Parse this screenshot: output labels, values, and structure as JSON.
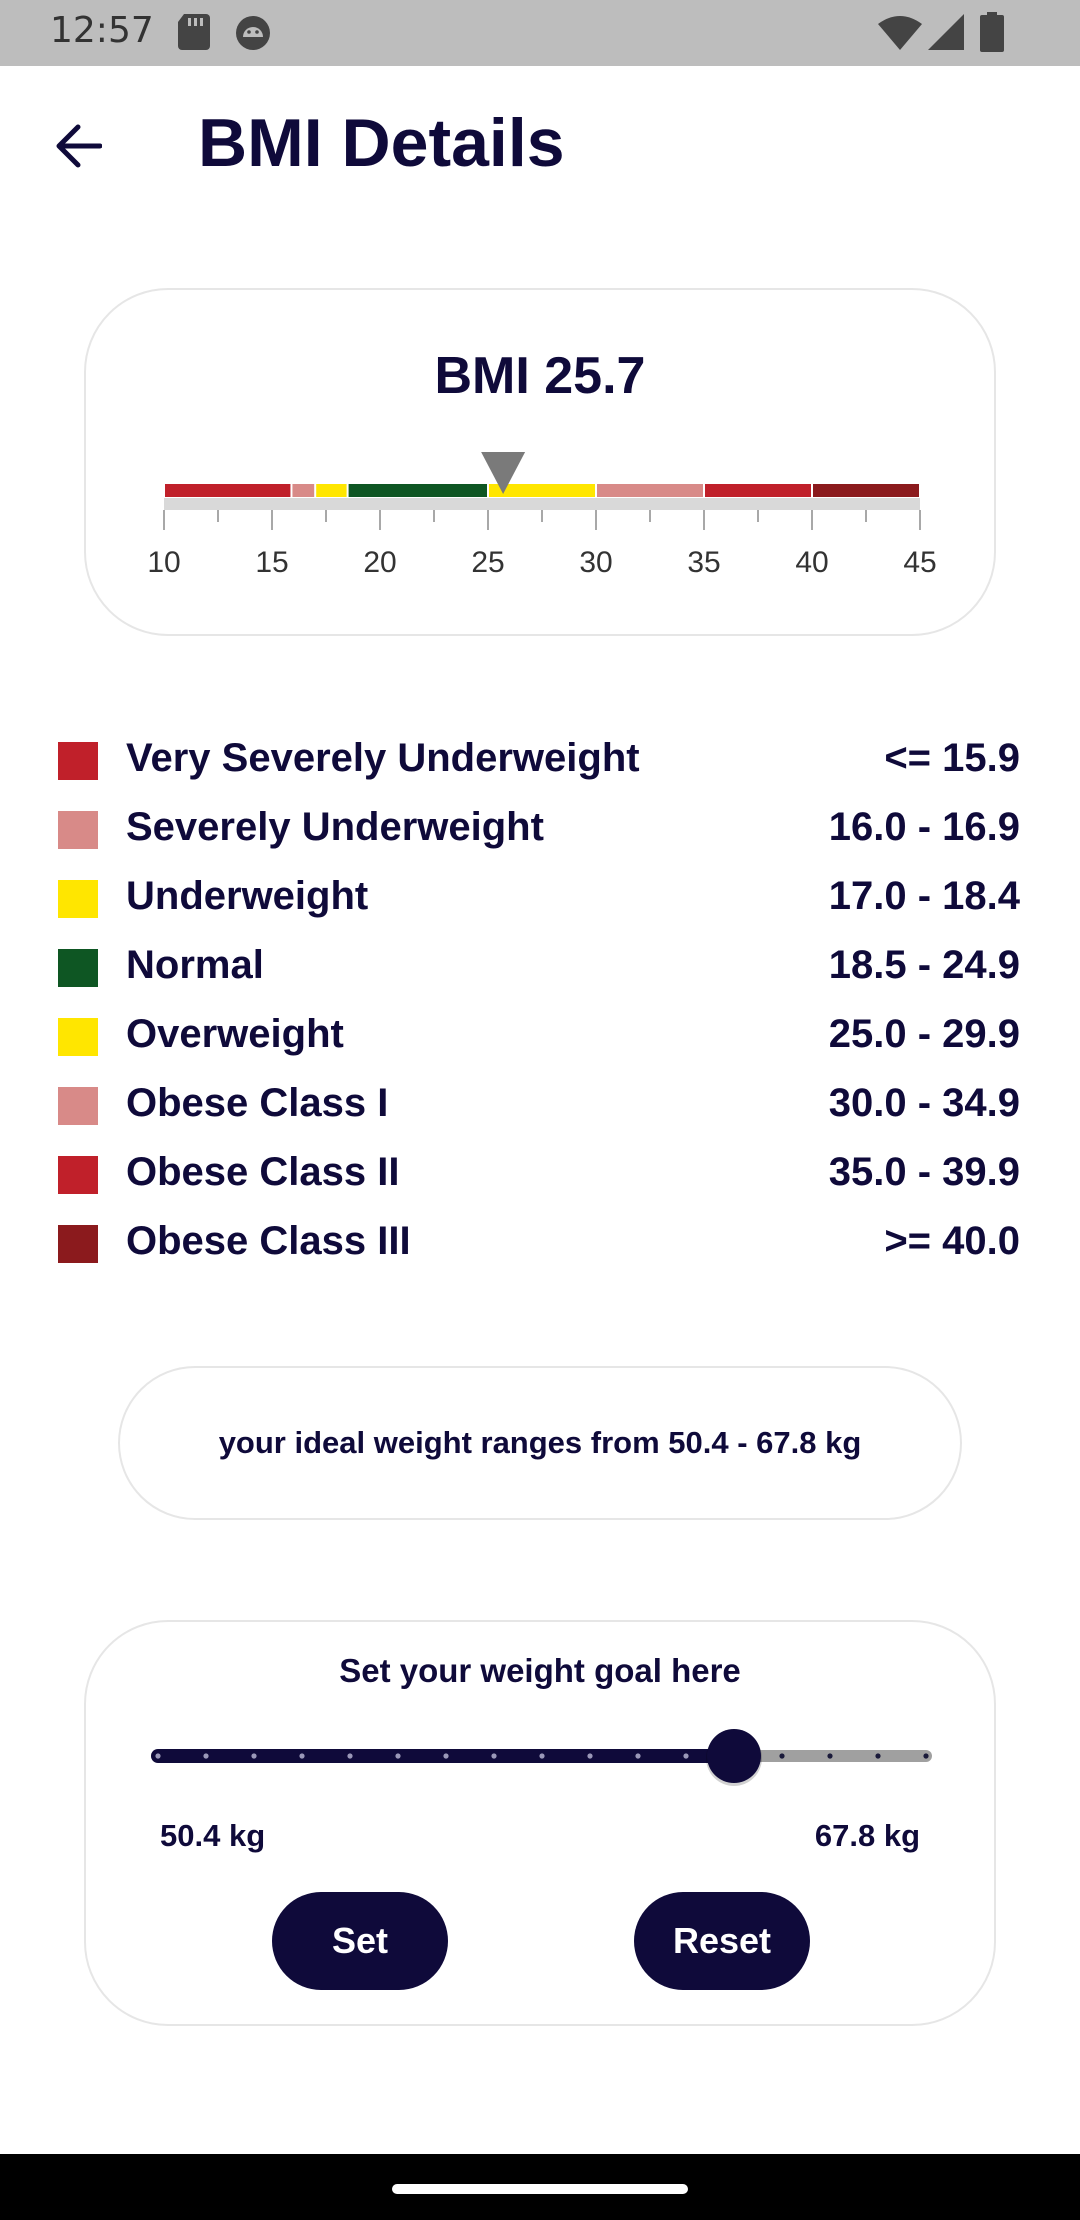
{
  "status_bar": {
    "time": "12:57",
    "left_icons": [
      "sd-card-icon",
      "android-debug-icon"
    ],
    "right_icons": [
      "wifi-icon",
      "signal-icon",
      "battery-icon"
    ]
  },
  "app_bar": {
    "back_icon": "arrow-left-icon",
    "title": "BMI Details"
  },
  "bmi": {
    "label": "BMI 25.7",
    "value": 25.7,
    "scale": {
      "min": 10,
      "max": 45,
      "tick_labels": [
        "10",
        "15",
        "20",
        "25",
        "30",
        "35",
        "40",
        "45"
      ],
      "segments": [
        {
          "from": 10,
          "to": 15.9,
          "color": "#c0202a"
        },
        {
          "from": 15.9,
          "to": 17.0,
          "color": "#d88a88"
        },
        {
          "from": 17.0,
          "to": 18.5,
          "color": "#ffe600"
        },
        {
          "from": 18.5,
          "to": 25.0,
          "color": "#0e5623"
        },
        {
          "from": 25.0,
          "to": 30.0,
          "color": "#ffe600"
        },
        {
          "from": 30.0,
          "to": 35.0,
          "color": "#d88a88"
        },
        {
          "from": 35.0,
          "to": 40.0,
          "color": "#c0202a"
        },
        {
          "from": 40.0,
          "to": 45.0,
          "color": "#8b1a1d"
        }
      ],
      "marker_color": "#7a7a7a",
      "track_color": "#d9d9d9"
    }
  },
  "legend": [
    {
      "label": "Very Severely Underweight",
      "range": "<= 15.9",
      "color": "#c0202a"
    },
    {
      "label": "Severely Underweight",
      "range": "16.0 - 16.9",
      "color": "#d88a88"
    },
    {
      "label": "Underweight",
      "range": "17.0 - 18.4",
      "color": "#ffe600"
    },
    {
      "label": "Normal",
      "range": "18.5 - 24.9",
      "color": "#0e5623"
    },
    {
      "label": "Overweight",
      "range": "25.0 - 29.9",
      "color": "#ffe600"
    },
    {
      "label": "Obese Class I",
      "range": "30.0 - 34.9",
      "color": "#d88a88"
    },
    {
      "label": "Obese Class II",
      "range": "35.0 - 39.9",
      "color": "#c0202a"
    },
    {
      "label": "Obese Class III",
      "range": ">= 40.0",
      "color": "#8b1a1d"
    }
  ],
  "ideal_weight": {
    "text": "your ideal weight ranges from 50.4 - 67.8 kg"
  },
  "weight_goal": {
    "title": "Set your weight goal here",
    "min_label": "50.4 kg",
    "max_label": "67.8 kg",
    "steps": 17,
    "selected_step": 12,
    "active_color": "#0f0a3a",
    "inactive_color": "#a0a0a0",
    "set_label": "Set",
    "reset_label": "Reset"
  },
  "nav_bar": {
    "home_icon": "home-pill-icon"
  }
}
